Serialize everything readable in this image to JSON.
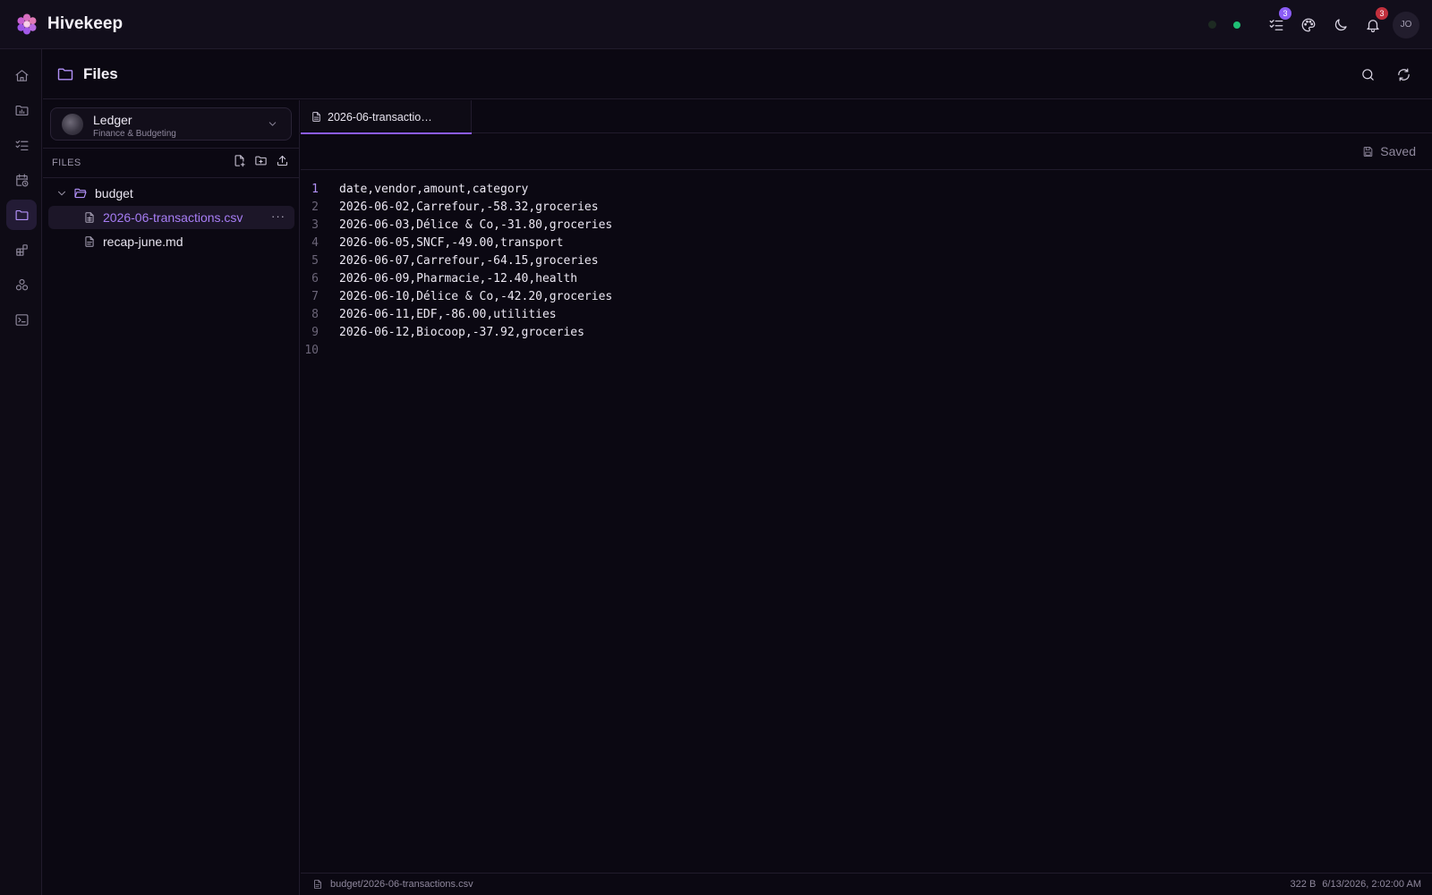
{
  "app": {
    "name": "Hivekeep",
    "user_initials": "JO",
    "tasks_badge": "3",
    "notifications_badge": "3",
    "accent": "#8b5cf6",
    "online_color": "#1fbf75"
  },
  "rail": {
    "items": [
      {
        "id": "home",
        "icon": "home-icon",
        "active": false
      },
      {
        "id": "projects",
        "icon": "folder-chart-icon",
        "active": false
      },
      {
        "id": "tasks",
        "icon": "checklist-icon",
        "active": false
      },
      {
        "id": "schedule",
        "icon": "calendar-clock-icon",
        "active": false
      },
      {
        "id": "files",
        "icon": "folder-icon",
        "active": true
      },
      {
        "id": "widgets",
        "icon": "blocks-icon",
        "active": false
      },
      {
        "id": "integrations",
        "icon": "cluster-icon",
        "active": false
      },
      {
        "id": "terminal",
        "icon": "terminal-icon",
        "active": false
      }
    ]
  },
  "page": {
    "title": "Files"
  },
  "project": {
    "name": "Ledger",
    "subtitle": "Finance & Budgeting"
  },
  "sidebar": {
    "section_label": "FILES",
    "tree": [
      {
        "type": "folder",
        "name": "budget",
        "expanded": true
      },
      {
        "type": "file",
        "name": "2026-06-transactions.csv",
        "selected": true
      },
      {
        "type": "file",
        "name": "recap-june.md",
        "selected": false
      }
    ]
  },
  "editor": {
    "tab_label": "2026-06-transactio…",
    "status": "Saved",
    "current_line": 1,
    "lines": [
      "date,vendor,amount,category",
      "2026-06-02,Carrefour,-58.32,groceries",
      "2026-06-03,Délice & Co,-31.80,groceries",
      "2026-06-05,SNCF,-49.00,transport",
      "2026-06-07,Carrefour,-64.15,groceries",
      "2026-06-09,Pharmacie,-12.40,health",
      "2026-06-10,Délice & Co,-42.20,groceries",
      "2026-06-11,EDF,-86.00,utilities",
      "2026-06-12,Biocoop,-37.92,groceries",
      ""
    ]
  },
  "statusbar": {
    "path": "budget/2026-06-transactions.csv",
    "size": "322 B",
    "modified": "6/13/2026, 2:02:00 AM"
  }
}
